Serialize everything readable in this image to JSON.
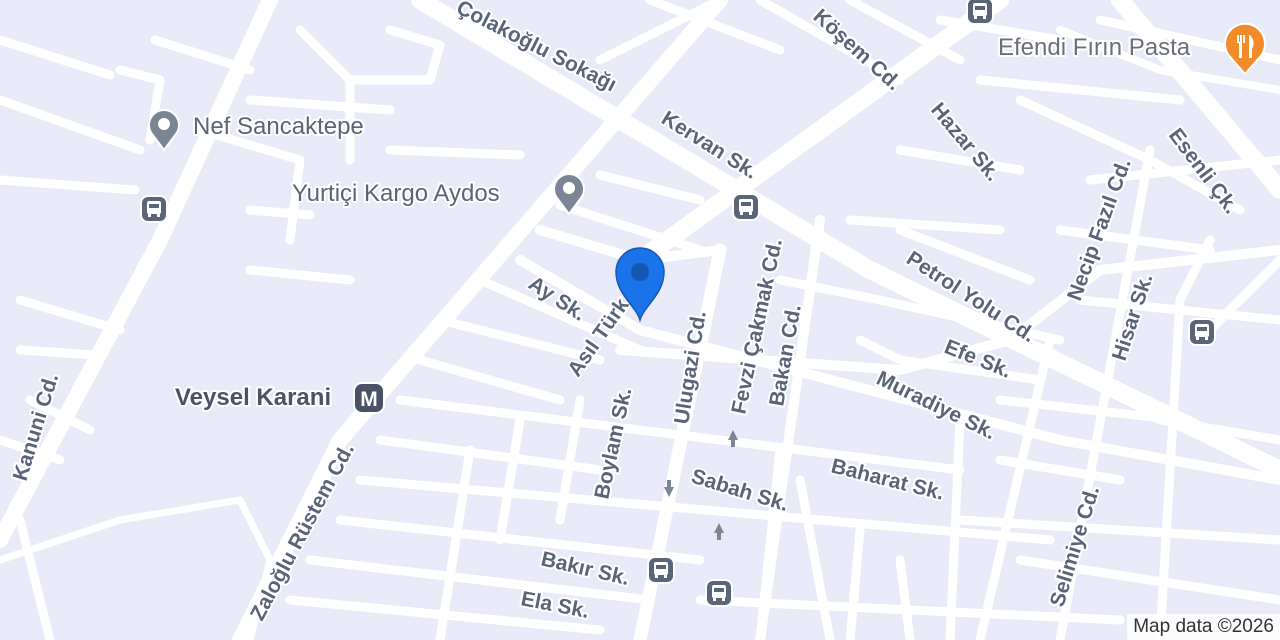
{
  "map": {
    "colors": {
      "background": "#e8ebf7",
      "road": "#ffffff",
      "poi_gray": "#7b8595",
      "bus_stop": "#5b6578",
      "metro": "#4a5366",
      "restaurant": "#f28b2a",
      "pin": "#1a73e8"
    },
    "streets": [
      "Çolakoğlu Sokağı",
      "Köşem Cd.",
      "Kervan Sk.",
      "Hazar Sk.",
      "Esenli Çk.",
      "Necip Fazıl Cd.",
      "Petrol Yolu Cd.",
      "Hisar Sk.",
      "Fevzi Çakmak Cd.",
      "Bakan Cd.",
      "Ulugazi Cd.",
      "Ay Sk.",
      "Asıl Türk Cd.",
      "Efe Sk.",
      "Muradiye Sk.",
      "Boylam Sk.",
      "Baharat Sk.",
      "Sabah Sk.",
      "Selimiye Cd.",
      "Bakır Sk.",
      "Ela Sk.",
      "Zaloğlu Rüstem Cd.",
      "Kanuni Cd."
    ],
    "places": [
      {
        "name": "Nef Sancaktepe",
        "icon": "place-pin-icon"
      },
      {
        "name": "Yurtiçi Kargo Aydos",
        "icon": "place-pin-icon"
      },
      {
        "name": "Efendi Fırın Pasta",
        "icon": "restaurant-icon"
      },
      {
        "name": "Veysel Karani",
        "icon": "metro-station-icon",
        "badge": "M"
      }
    ],
    "attribution": "Map data ©2026"
  }
}
